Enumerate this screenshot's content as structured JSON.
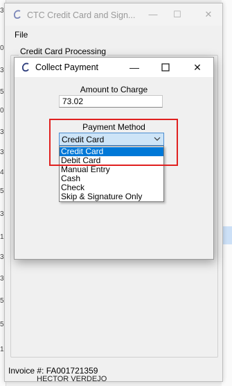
{
  "background": {
    "left_numbers": [
      "3",
      "0",
      "3",
      "5",
      "0",
      "3",
      "3",
      "4",
      "5",
      "3",
      "1",
      "3",
      "3",
      "5",
      "5",
      "1"
    ],
    "bottom_text": "HECTOR VERDEJO"
  },
  "main_window": {
    "title": "CTC Credit Card and Sign...",
    "menu": [
      "File"
    ],
    "group_label": "Credit Card Processing",
    "invoice_text": "Invoice #: FA001721359"
  },
  "dialog": {
    "title": "Collect Payment",
    "amount_label": "Amount to Charge",
    "amount_value": "73.02",
    "payment_method_label": "Payment Method",
    "selected_method": "Credit Card",
    "options": [
      {
        "label": "Credit Card",
        "highlighted": true
      },
      {
        "label": "Debit Card",
        "highlighted": false
      },
      {
        "label": "Manual Entry",
        "highlighted": false
      },
      {
        "label": "Cash",
        "highlighted": false
      },
      {
        "label": "Check",
        "highlighted": false
      },
      {
        "label": "Skip & Signature Only",
        "highlighted": false
      }
    ]
  },
  "colors": {
    "selection": "#0078d7",
    "annotation": "#e0201f",
    "select_bg": "#cde4f7"
  }
}
